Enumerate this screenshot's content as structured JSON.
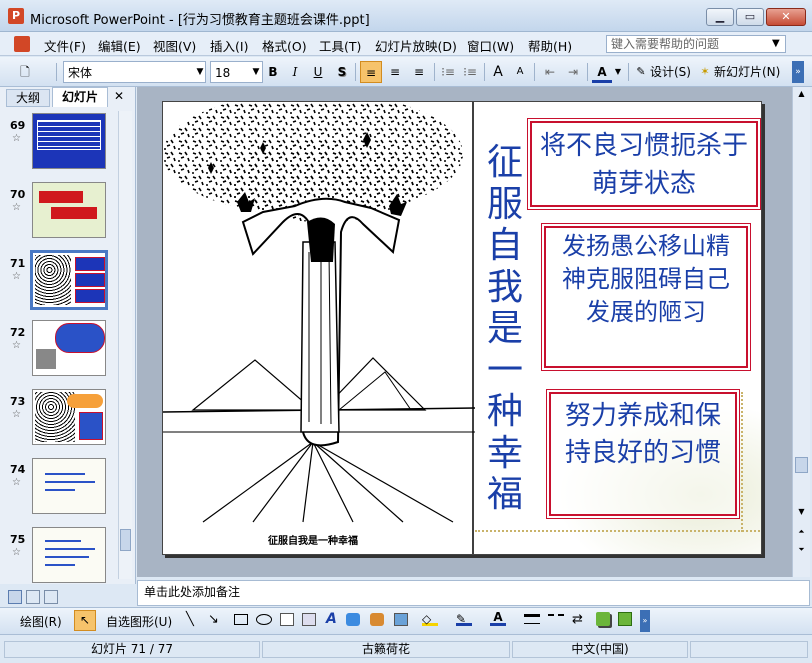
{
  "window": {
    "app_icon": "P",
    "title": "Microsoft PowerPoint - [行为习惯教育主题班会课件.ppt]",
    "min": "▁",
    "max": "▭",
    "close": "✕"
  },
  "menu": [
    "文件(F)",
    "编辑(E)",
    "视图(V)",
    "插入(I)",
    "格式(O)",
    "工具(T)",
    "幻灯片放映(D)",
    "窗口(W)",
    "帮助(H)"
  ],
  "help_placeholder": "键入需要帮助的问题",
  "toolbar": {
    "font": "宋体",
    "size": "18",
    "bold": "B",
    "italic": "I",
    "underline": "U",
    "shadow": "S",
    "grow": "A",
    "shrink": "A",
    "font_color": "A",
    "design": "设计(S)",
    "new_slide": "新幻灯片(N)"
  },
  "panel_tabs": {
    "outline": "大纲",
    "slides": "幻灯片",
    "close": "✕"
  },
  "thumbnails": [
    {
      "num": "69",
      "star": "☆"
    },
    {
      "num": "70",
      "star": "☆"
    },
    {
      "num": "71",
      "star": "☆"
    },
    {
      "num": "72",
      "star": "☆"
    },
    {
      "num": "73",
      "star": "☆"
    },
    {
      "num": "74",
      "star": "☆"
    },
    {
      "num": "75",
      "star": "☆"
    }
  ],
  "slide": {
    "caption": "征服自我是一种幸福",
    "vertical_title": "征服自我是一种幸福",
    "box1": "将不良习惯扼杀于萌芽状态",
    "box2": "发扬愚公移山精神克服阻碍自己发展的陋习",
    "box3": "努力养成和保持良好的习惯"
  },
  "notes": "单击此处添加备注",
  "drawbar": {
    "draw": "绘图(R)",
    "autoshape": "自选图形(U)"
  },
  "status": {
    "slide": "幻灯片 71 / 77",
    "design": "古籁荷花",
    "lang": "中文(中国)"
  },
  "colors": {
    "accent_red": "#c8102e",
    "text_blue": "#1a3fa8"
  }
}
